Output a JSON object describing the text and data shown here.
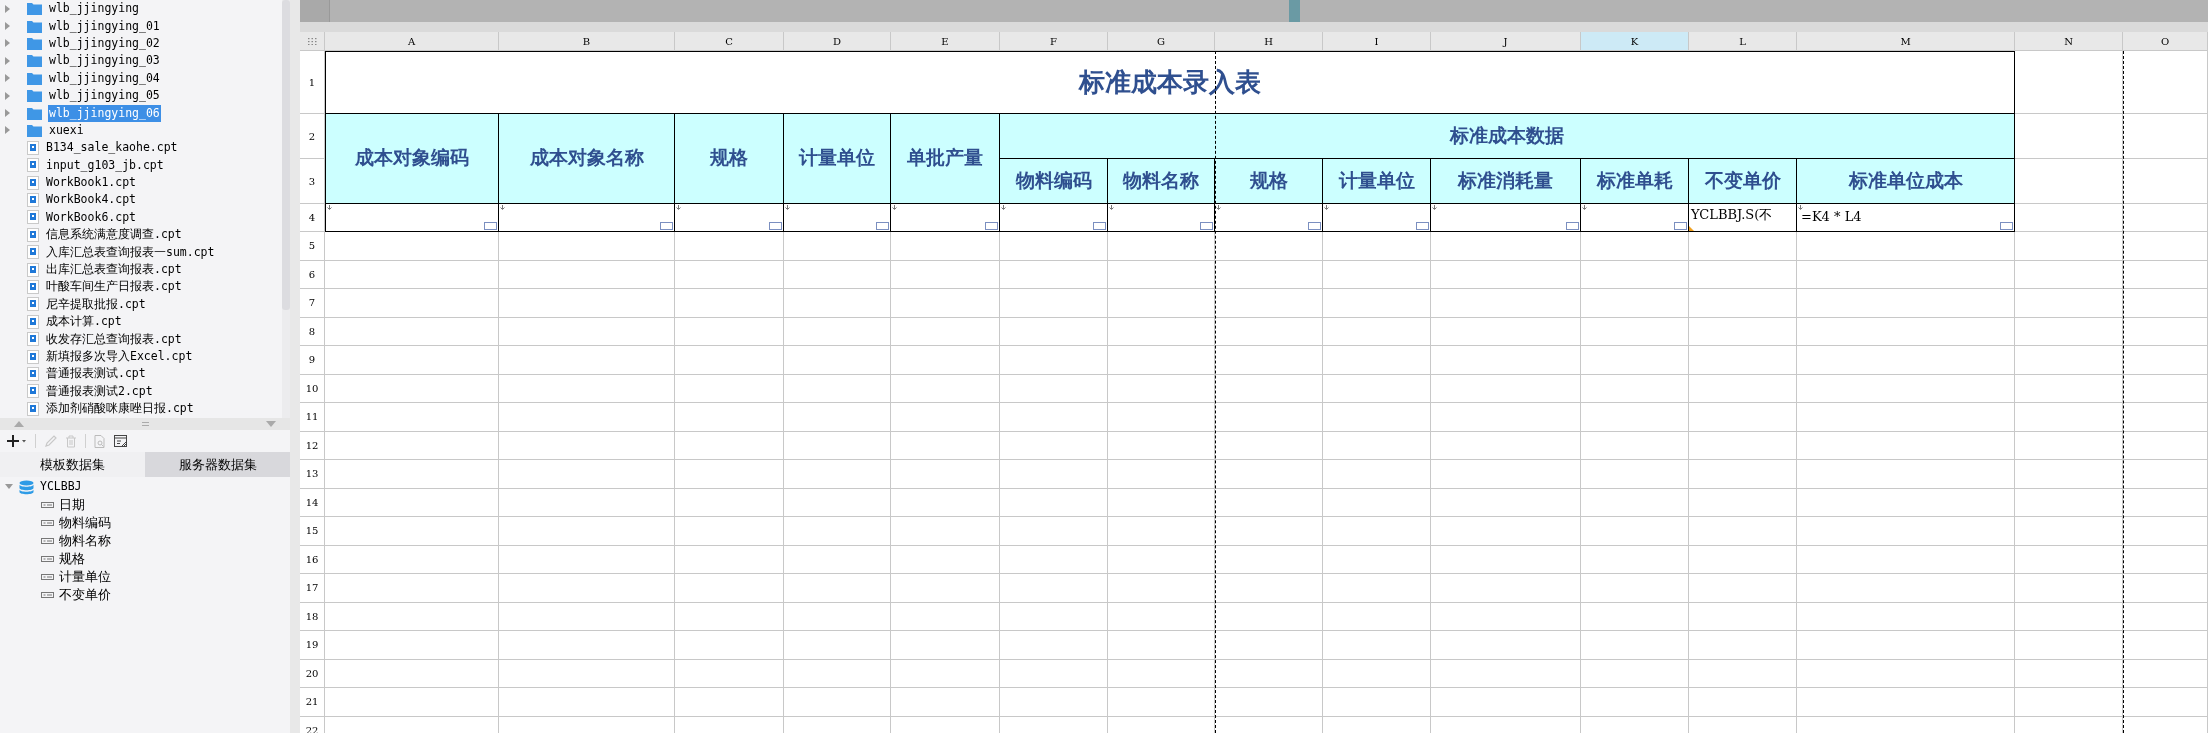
{
  "file_tree": {
    "items": [
      {
        "label": "wlb_jjingying",
        "kind": "folder",
        "expanded": false,
        "selected": false
      },
      {
        "label": "wlb_jjingying_01",
        "kind": "folder",
        "expanded": false,
        "selected": false
      },
      {
        "label": "wlb_jjingying_02",
        "kind": "folder",
        "expanded": false,
        "selected": false
      },
      {
        "label": "wlb_jjingying_03",
        "kind": "folder",
        "expanded": false,
        "selected": false
      },
      {
        "label": "wlb_jjingying_04",
        "kind": "folder",
        "expanded": false,
        "selected": false
      },
      {
        "label": "wlb_jjingying_05",
        "kind": "folder",
        "expanded": false,
        "selected": false
      },
      {
        "label": "wlb_jjingying_06",
        "kind": "folder",
        "expanded": false,
        "selected": true
      },
      {
        "label": "xuexi",
        "kind": "folder",
        "expanded": false,
        "selected": false
      },
      {
        "label": "B134_sale_kaohe.cpt",
        "kind": "file",
        "selected": false
      },
      {
        "label": "input_g103_jb.cpt",
        "kind": "file",
        "selected": false
      },
      {
        "label": "WorkBook1.cpt",
        "kind": "file",
        "selected": false
      },
      {
        "label": "WorkBook4.cpt",
        "kind": "file",
        "selected": false
      },
      {
        "label": "WorkBook6.cpt",
        "kind": "file",
        "selected": false
      },
      {
        "label": "信息系统满意度调查.cpt",
        "kind": "file",
        "selected": false
      },
      {
        "label": "入库汇总表查询报表一sum.cpt",
        "kind": "file",
        "selected": false
      },
      {
        "label": "出库汇总表查询报表.cpt",
        "kind": "file",
        "selected": false
      },
      {
        "label": "叶酸车间生产日报表.cpt",
        "kind": "file",
        "selected": false
      },
      {
        "label": "尼辛提取批报.cpt",
        "kind": "file",
        "selected": false
      },
      {
        "label": "成本计算.cpt",
        "kind": "file",
        "selected": false
      },
      {
        "label": "收发存汇总查询报表.cpt",
        "kind": "file",
        "selected": false
      },
      {
        "label": "新填报多次导入Excel.cpt",
        "kind": "file",
        "selected": false
      },
      {
        "label": "普通报表测试.cpt",
        "kind": "file",
        "selected": false
      },
      {
        "label": "普通报表测试2.cpt",
        "kind": "file",
        "selected": false
      },
      {
        "label": "添加剂硝酸咪康唑日报.cpt",
        "kind": "file",
        "selected": false
      }
    ]
  },
  "dataset_tabs": [
    {
      "label": "模板数据集",
      "selected": true
    },
    {
      "label": "服务器数据集",
      "selected": false
    }
  ],
  "dataset_tree": {
    "name": "YCLBBJ",
    "expanded": true,
    "children": [
      {
        "label": "日期"
      },
      {
        "label": "物料编码"
      },
      {
        "label": "物料名称"
      },
      {
        "label": "规格"
      },
      {
        "label": "计量单位"
      },
      {
        "label": "不变单价"
      }
    ]
  },
  "sheet": {
    "column_headers": [
      {
        "label": "A",
        "selected": false
      },
      {
        "label": "B",
        "selected": false
      },
      {
        "label": "C",
        "selected": false
      },
      {
        "label": "D",
        "selected": false
      },
      {
        "label": "E",
        "selected": false
      },
      {
        "label": "F",
        "selected": false
      },
      {
        "label": "G",
        "selected": false
      },
      {
        "label": "H",
        "selected": false
      },
      {
        "label": "I",
        "selected": false
      },
      {
        "label": "J",
        "selected": false
      },
      {
        "label": "K",
        "selected": true
      },
      {
        "label": "L",
        "selected": false
      },
      {
        "label": "M",
        "selected": false
      },
      {
        "label": "N",
        "selected": false
      },
      {
        "label": "O",
        "selected": false
      }
    ],
    "row_numbers": [
      "1",
      "2",
      "3",
      "4",
      "5",
      "6",
      "7",
      "8",
      "9",
      "10",
      "11",
      "12",
      "13",
      "14",
      "15",
      "16",
      "17",
      "18",
      "19",
      "20",
      "21",
      "22"
    ],
    "title": "标准成本录入表",
    "header_cells": [
      "成本对象编码",
      "成本对象名称",
      "规格",
      "计量单位",
      "单批产量"
    ],
    "group_header": "标准成本数据",
    "sub_headers": [
      "物料编码",
      "物料名称",
      "规格",
      "计量单位",
      "标准消耗量",
      "标准单耗",
      "不变单价",
      "标准单位成本"
    ],
    "cell_l4": "YCLBBJ.S(不",
    "cell_m4": "=K4 * L4"
  }
}
